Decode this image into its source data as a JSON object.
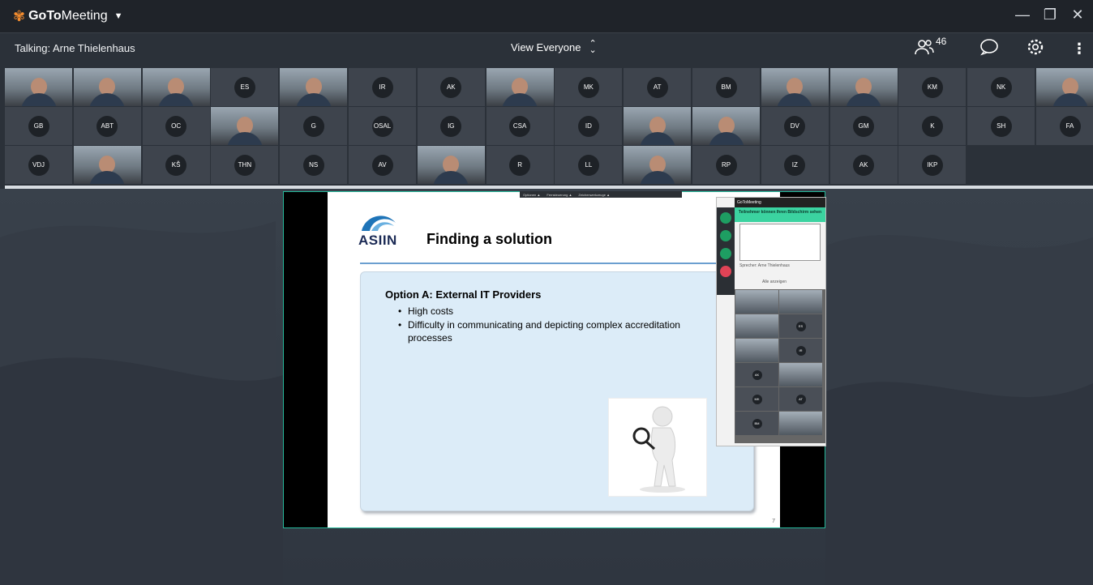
{
  "app": {
    "logo_prefix": "GoTo",
    "logo_suffix": "Meeting"
  },
  "toolbar": {
    "talking": "Talking: Arne Thielenhaus",
    "view_label": "View Everyone",
    "participant_count": "46"
  },
  "participants_row1": [
    "",
    "",
    "",
    "ES",
    "",
    "IR",
    "AK",
    "",
    "MK",
    "AT",
    "BM",
    "",
    "",
    "KM",
    "NK",
    ""
  ],
  "participants_row2": [
    "GB",
    "ABT",
    "OC",
    "",
    "G",
    "OSAL",
    "IG",
    "CSA",
    "ID",
    "",
    "",
    "DV",
    "GM",
    "K",
    "SH",
    "FA"
  ],
  "participants_row3": [
    "VDJ",
    "",
    "KŠ",
    "THN",
    "NS",
    "AV",
    "",
    "R",
    "LL",
    "",
    "RP",
    "IZ",
    "AK",
    "IKP"
  ],
  "slide": {
    "logo_text": "ASIIN",
    "title": "Finding a solution",
    "option_heading": "Option A: External IT Providers",
    "bullets": [
      "High costs",
      "Difficulty in communicating and depicting complex accreditation processes"
    ],
    "page_number": "7"
  },
  "share_toolbar": [
    "Optionen ▲",
    "Fernsteuerung ▲",
    "Zeichenwerkzeuge ▲"
  ],
  "mini_window": {
    "title": "GoToMeeting",
    "banner": "Teilnehmer können Ihren Bildschirm sehen",
    "speaker": "Sprecher: Arne Thielenhaus",
    "view_all": "Alle anzeigen",
    "tiles": [
      "",
      "",
      "",
      "ES",
      "",
      "IR",
      "AK",
      "",
      "MK",
      "AT",
      "BM",
      ""
    ]
  }
}
